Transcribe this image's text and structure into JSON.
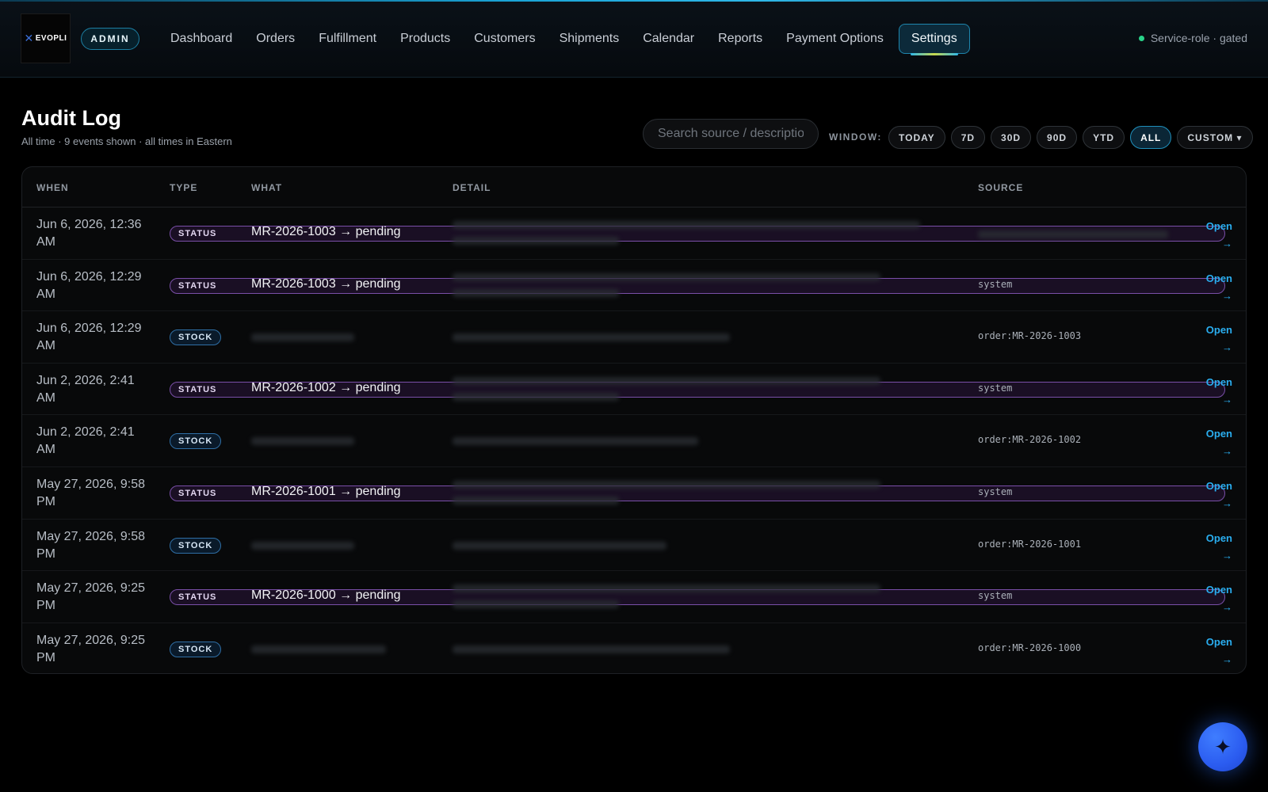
{
  "header": {
    "logo_text": "EVOPLI",
    "badge": "ADMIN",
    "nav": [
      {
        "label": "Dashboard"
      },
      {
        "label": "Orders"
      },
      {
        "label": "Fulfillment"
      },
      {
        "label": "Products"
      },
      {
        "label": "Customers"
      },
      {
        "label": "Shipments"
      },
      {
        "label": "Calendar"
      },
      {
        "label": "Reports"
      },
      {
        "label": "Payment Options"
      },
      {
        "label": "Settings",
        "active": true
      }
    ],
    "status_text": "Service-role · gated",
    "status_color": "#29d38a"
  },
  "page": {
    "title": "Audit Log",
    "subtitle": "All time · 9 events shown · all times in Eastern"
  },
  "search": {
    "placeholder": "Search source / description",
    "value": ""
  },
  "window": {
    "label": "WINDOW:",
    "options": [
      "TODAY",
      "7D",
      "30D",
      "90D",
      "YTD",
      "ALL",
      "CUSTOM ▾"
    ],
    "selected": "ALL"
  },
  "table": {
    "columns": [
      "WHEN",
      "TYPE",
      "WHAT",
      "DETAIL",
      "SOURCE"
    ],
    "open_label": "Open",
    "open_arrow": "→",
    "rows": [
      {
        "when": "Jun 6, 2026, 12:36 AM",
        "type": "STATUS",
        "what": "MR-2026-1003 → pending",
        "source": ""
      },
      {
        "when": "Jun 6, 2026, 12:29 AM",
        "type": "STATUS",
        "what": "MR-2026-1003 → pending",
        "source": "system"
      },
      {
        "when": "Jun 6, 2026, 12:29 AM",
        "type": "STOCK",
        "what": "",
        "source": "order:MR-2026-1003"
      },
      {
        "when": "Jun 2, 2026, 2:41 AM",
        "type": "STATUS",
        "what": "MR-2026-1002 → pending",
        "source": "system"
      },
      {
        "when": "Jun 2, 2026, 2:41 AM",
        "type": "STOCK",
        "what": "",
        "source": "order:MR-2026-1002"
      },
      {
        "when": "May 27, 2026, 9:58 PM",
        "type": "STATUS",
        "what": "MR-2026-1001 → pending",
        "source": "system"
      },
      {
        "when": "May 27, 2026, 9:58 PM",
        "type": "STOCK",
        "what": "",
        "source": "order:MR-2026-1001"
      },
      {
        "when": "May 27, 2026, 9:25 PM",
        "type": "STATUS",
        "what": "MR-2026-1000 → pending",
        "source": "system"
      },
      {
        "when": "May 27, 2026, 9:25 PM",
        "type": "STOCK",
        "what": "",
        "source": "order:MR-2026-1000"
      }
    ]
  },
  "fab": {
    "icon": "sparkle-icon",
    "glyph": "✦"
  }
}
